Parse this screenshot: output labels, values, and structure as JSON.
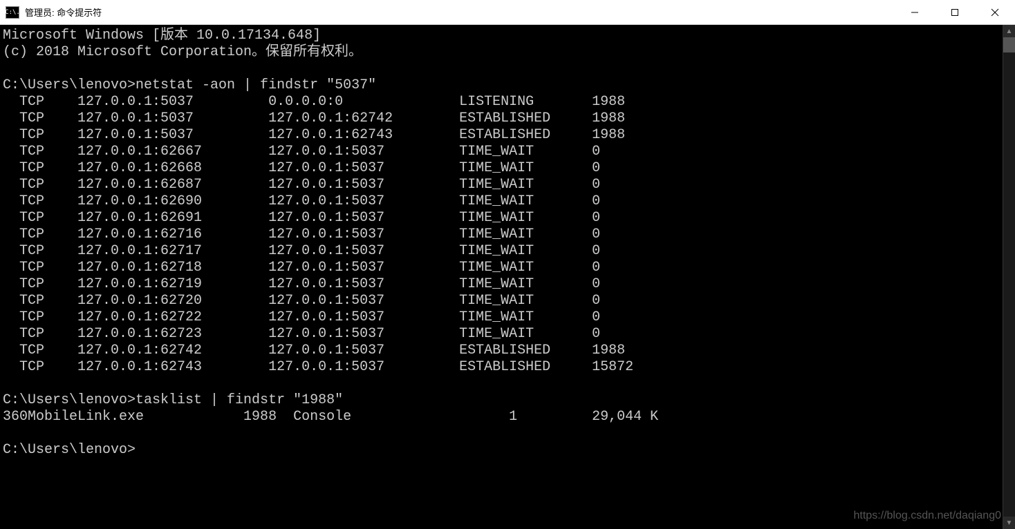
{
  "window": {
    "title": "管理员: 命令提示符",
    "icon_label": "C:\\."
  },
  "header": {
    "line1": "Microsoft Windows [版本 10.0.17134.648]",
    "line2": "(c) 2018 Microsoft Corporation。保留所有权利。"
  },
  "prompt1": {
    "path": "C:\\Users\\lenovo>",
    "command": "netstat -aon | findstr \"5037\""
  },
  "netstat_rows": [
    {
      "proto": "TCP",
      "local": "127.0.0.1:5037",
      "foreign": "0.0.0.0:0",
      "state": "LISTENING",
      "pid": "1988"
    },
    {
      "proto": "TCP",
      "local": "127.0.0.1:5037",
      "foreign": "127.0.0.1:62742",
      "state": "ESTABLISHED",
      "pid": "1988"
    },
    {
      "proto": "TCP",
      "local": "127.0.0.1:5037",
      "foreign": "127.0.0.1:62743",
      "state": "ESTABLISHED",
      "pid": "1988"
    },
    {
      "proto": "TCP",
      "local": "127.0.0.1:62667",
      "foreign": "127.0.0.1:5037",
      "state": "TIME_WAIT",
      "pid": "0"
    },
    {
      "proto": "TCP",
      "local": "127.0.0.1:62668",
      "foreign": "127.0.0.1:5037",
      "state": "TIME_WAIT",
      "pid": "0"
    },
    {
      "proto": "TCP",
      "local": "127.0.0.1:62687",
      "foreign": "127.0.0.1:5037",
      "state": "TIME_WAIT",
      "pid": "0"
    },
    {
      "proto": "TCP",
      "local": "127.0.0.1:62690",
      "foreign": "127.0.0.1:5037",
      "state": "TIME_WAIT",
      "pid": "0"
    },
    {
      "proto": "TCP",
      "local": "127.0.0.1:62691",
      "foreign": "127.0.0.1:5037",
      "state": "TIME_WAIT",
      "pid": "0"
    },
    {
      "proto": "TCP",
      "local": "127.0.0.1:62716",
      "foreign": "127.0.0.1:5037",
      "state": "TIME_WAIT",
      "pid": "0"
    },
    {
      "proto": "TCP",
      "local": "127.0.0.1:62717",
      "foreign": "127.0.0.1:5037",
      "state": "TIME_WAIT",
      "pid": "0"
    },
    {
      "proto": "TCP",
      "local": "127.0.0.1:62718",
      "foreign": "127.0.0.1:5037",
      "state": "TIME_WAIT",
      "pid": "0"
    },
    {
      "proto": "TCP",
      "local": "127.0.0.1:62719",
      "foreign": "127.0.0.1:5037",
      "state": "TIME_WAIT",
      "pid": "0"
    },
    {
      "proto": "TCP",
      "local": "127.0.0.1:62720",
      "foreign": "127.0.0.1:5037",
      "state": "TIME_WAIT",
      "pid": "0"
    },
    {
      "proto": "TCP",
      "local": "127.0.0.1:62722",
      "foreign": "127.0.0.1:5037",
      "state": "TIME_WAIT",
      "pid": "0"
    },
    {
      "proto": "TCP",
      "local": "127.0.0.1:62723",
      "foreign": "127.0.0.1:5037",
      "state": "TIME_WAIT",
      "pid": "0"
    },
    {
      "proto": "TCP",
      "local": "127.0.0.1:62742",
      "foreign": "127.0.0.1:5037",
      "state": "ESTABLISHED",
      "pid": "1988"
    },
    {
      "proto": "TCP",
      "local": "127.0.0.1:62743",
      "foreign": "127.0.0.1:5037",
      "state": "ESTABLISHED",
      "pid": "15872"
    }
  ],
  "prompt2": {
    "path": "C:\\Users\\lenovo>",
    "command": "tasklist | findstr \"1988\""
  },
  "tasklist_row": {
    "image": "360MobileLink.exe",
    "pid": "1988",
    "session_name": "Console",
    "session_num": "1",
    "mem": "29,044 K"
  },
  "prompt3": {
    "path": "C:\\Users\\lenovo>"
  },
  "watermark": "https://blog.csdn.net/daqiang0"
}
